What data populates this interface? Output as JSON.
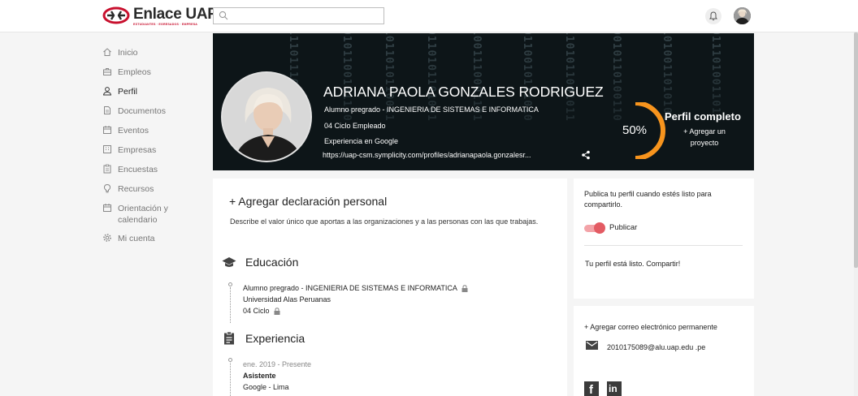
{
  "header": {
    "logo_text": "Enlace UAP",
    "logo_subtitle": "ESTUDIANTES · EGRESADOS · EMPRESA",
    "search": {
      "value": "",
      "placeholder": ""
    },
    "icons": [
      "search-icon",
      "bell-icon",
      "user-avatar"
    ]
  },
  "sidebar": {
    "items": [
      {
        "label": "Inicio",
        "icon": "home-icon",
        "active": false
      },
      {
        "label": "Empleos",
        "icon": "briefcase-icon",
        "active": false
      },
      {
        "label": "Perfil",
        "icon": "person-icon",
        "active": true
      },
      {
        "label": "Documentos",
        "icon": "document-icon",
        "active": false
      },
      {
        "label": "Eventos",
        "icon": "calendar-icon",
        "active": false
      },
      {
        "label": "Empresas",
        "icon": "building-icon",
        "active": false
      },
      {
        "label": "Encuestas",
        "icon": "survey-icon",
        "active": false
      },
      {
        "label": "Recursos",
        "icon": "lightbulb-icon",
        "active": false
      },
      {
        "label": "Orientación y calendario",
        "icon": "calendar-icon",
        "active": false
      },
      {
        "label": "Mi cuenta",
        "icon": "gear-icon",
        "active": false
      }
    ]
  },
  "profile": {
    "name": "ADRIANA PAOLA GONZALES RODRIGUEZ",
    "program": "Alumno pregrado - INGENIERIA DE SISTEMAS E INFORMATICA",
    "cycle": "04 Ciclo Empleado",
    "experience": "Experiencia en Google",
    "url": "https://uap-csm.symplicity.com/profiles/adrianapaola.gonzalesr...",
    "completion_percent": 50,
    "completion_label": "50%",
    "completion_title": "Perfil completo",
    "add_project": "+ Agregar un proyecto"
  },
  "main": {
    "add_statement": "+ Agregar declaración personal",
    "statement_desc": "Describe el valor único que aportas a las organizaciones y a las personas con las que trabajas.",
    "education": {
      "title": "Educación",
      "program": "Alumno pregrado  - INGENIERIA DE SISTEMAS E INFORMATICA",
      "school": "Universidad Alas Peruanas",
      "cycle": "04 Ciclo"
    },
    "experience": {
      "title": "Experiencia",
      "dates": "ene. 2019 - Presente",
      "role": "Asistente",
      "company": "Google - Lima"
    }
  },
  "aside": {
    "publish_text": "Publica tu perfil cuando estés listo para compartirlo.",
    "publish_label": "Publicar",
    "publish_on": true,
    "ready_text": "Tu perfil está listo. Compartir!",
    "add_email": "+ Agregar correo electrónico permanente",
    "email": "2010175089@alu.uap.edu .pe",
    "social": {
      "facebook": "f",
      "linkedin": "in"
    }
  },
  "colors": {
    "accent": "#f7941d",
    "toggle_knob": "#e35b63",
    "toggle_track": "#f3a3a8",
    "logo_red": "#c8102e",
    "banner_bg": "#0d1518"
  }
}
